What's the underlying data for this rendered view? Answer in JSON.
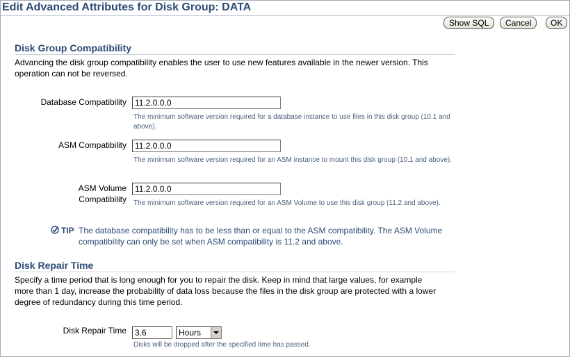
{
  "page": {
    "title": "Edit Advanced Attributes for Disk Group: DATA"
  },
  "buttons": {
    "show_sql": "Show SQL",
    "cancel": "Cancel",
    "ok": "OK"
  },
  "compatibility": {
    "title": "Disk Group Compatibility",
    "description": "Advancing the disk group compatibility enables the user to use new features available in the newer version. This operation can not be reversed.",
    "database": {
      "label": "Database Compatibility",
      "value": "11.2.0.0.0",
      "hint": "The minimum software version required for a database instance to use files in this disk group (10.1 and above)."
    },
    "asm": {
      "label": "ASM Compatibility",
      "value": "11.2.0.0.0",
      "hint": "The minimum software version required for an ASM instance to mount this disk group (10.1 and above)."
    },
    "volume": {
      "label_line1": "ASM Volume",
      "label_line2": "Compatibility",
      "value": "11.2.0.0.0",
      "hint": "The minimum software version required for an ASM Volume to use this disk group (11.2 and above)."
    },
    "tip": {
      "icon": "checkmark-icon",
      "label": "TIP",
      "text": "The database compatibility has to be less than or equal to the ASM compatibility. The ASM Volume compatibility can only be set when ASM compatibility is 11.2 and above."
    }
  },
  "repair": {
    "title": "Disk Repair Time",
    "description": "Specify a time period that is long enough for you to repair the disk. Keep in mind that large values, for example more than 1 day, increase the probability of data loss because the files in the disk group are protected with a lower degree of redundancy during this time period.",
    "label": "Disk Repair Time",
    "value": "3.6",
    "unit": "Hours",
    "hint": "Disks will be dropped after the specified time has passed."
  }
}
